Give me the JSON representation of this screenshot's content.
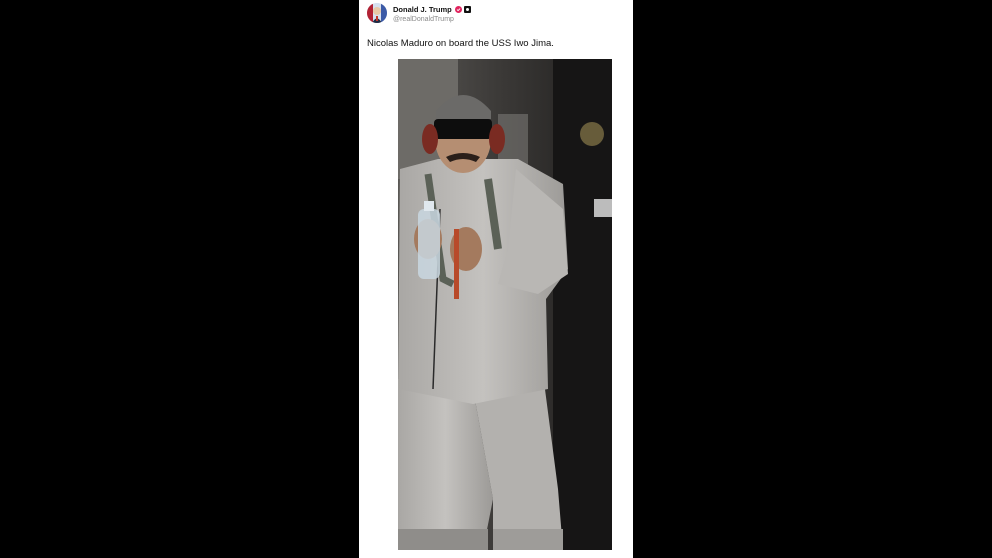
{
  "post": {
    "display_name": "Donald J. Trump",
    "handle": "@realDonaldTrump",
    "text": "Nicolas Maduro on board the USS Iwo Jima.",
    "verified_icon": "verified-badge-icon",
    "affiliation_icon": "affiliation-badge-icon"
  },
  "colors": {
    "background": "#000000",
    "card": "#ffffff",
    "verified": "#e0245e"
  }
}
